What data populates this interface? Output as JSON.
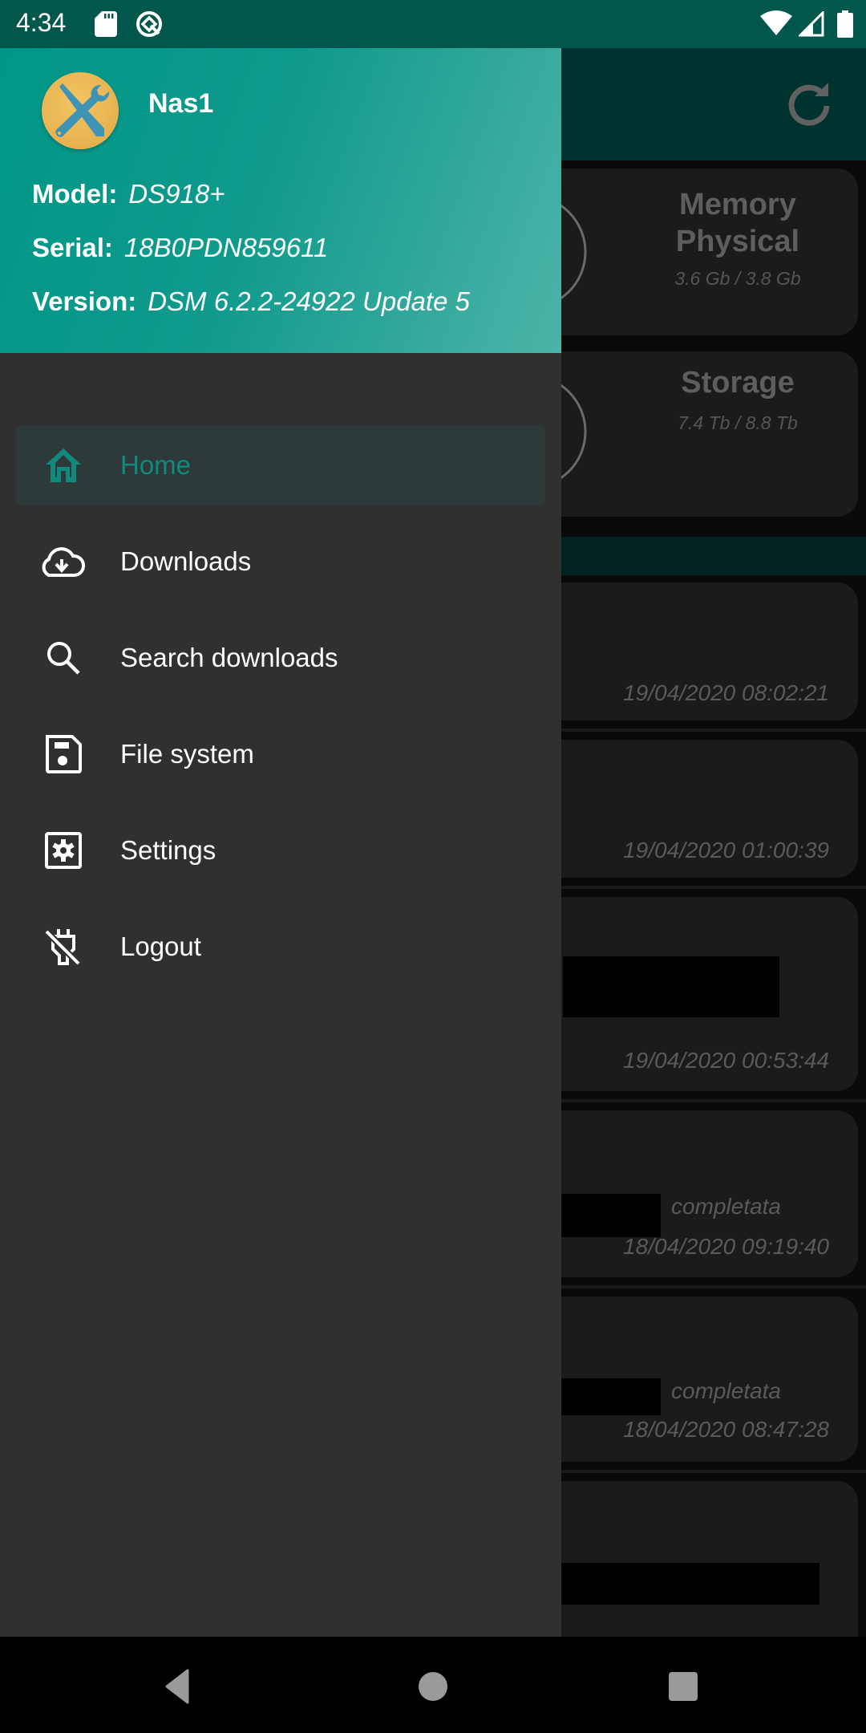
{
  "status_bar": {
    "time": "4:34",
    "left_icons": [
      "sd-card-icon",
      "q-notification-icon"
    ],
    "right_icons": [
      "wifi-icon",
      "cell-signal-icon",
      "battery-icon"
    ]
  },
  "drawer": {
    "header": {
      "avatar_icon": "tools-icon",
      "device_name": "Nas1",
      "info": [
        {
          "label": "Model:",
          "value": "DS918+"
        },
        {
          "label": "Serial:",
          "value": "18B0PDN859611"
        },
        {
          "label": "Version:",
          "value": "DSM 6.2.2-24922 Update 5"
        }
      ]
    },
    "menu": [
      {
        "label": "Home",
        "icon": "home-icon",
        "active": true
      },
      {
        "label": "Downloads",
        "icon": "cloud-download-icon",
        "active": false
      },
      {
        "label": "Search downloads",
        "icon": "search-icon",
        "active": false
      },
      {
        "label": "File system",
        "icon": "sd-storage-icon",
        "active": false
      },
      {
        "label": "Settings",
        "icon": "settings-box-icon",
        "active": false
      },
      {
        "label": "Logout",
        "icon": "power-off-icon",
        "active": false
      }
    ],
    "accent_color": "#0f8a7c"
  },
  "background_app": {
    "toolbar": {
      "refresh_icon": "refresh-icon"
    },
    "gauges": [
      {
        "title": "Memory Physical",
        "value": "3.6 Gb / 3.8 Gb",
        "used_fraction": 0.95
      },
      {
        "title": "Storage",
        "value": "7.4 Tb / 8.8 Tb",
        "used_fraction": 0.84
      }
    ],
    "downloads": [
      {
        "status": "",
        "timestamp": "19/04/2020 08:02:21"
      },
      {
        "status": "",
        "timestamp": "19/04/2020 01:00:39"
      },
      {
        "status": "",
        "timestamp": "19/04/2020 00:53:44"
      },
      {
        "status": "completata",
        "timestamp": "18/04/2020 09:19:40"
      },
      {
        "status": "completata",
        "timestamp": "18/04/2020 08:47:28"
      },
      {
        "status": "",
        "timestamp": ""
      }
    ]
  },
  "nav_bar": {
    "buttons": [
      "back-button",
      "home-button",
      "recents-button"
    ]
  }
}
